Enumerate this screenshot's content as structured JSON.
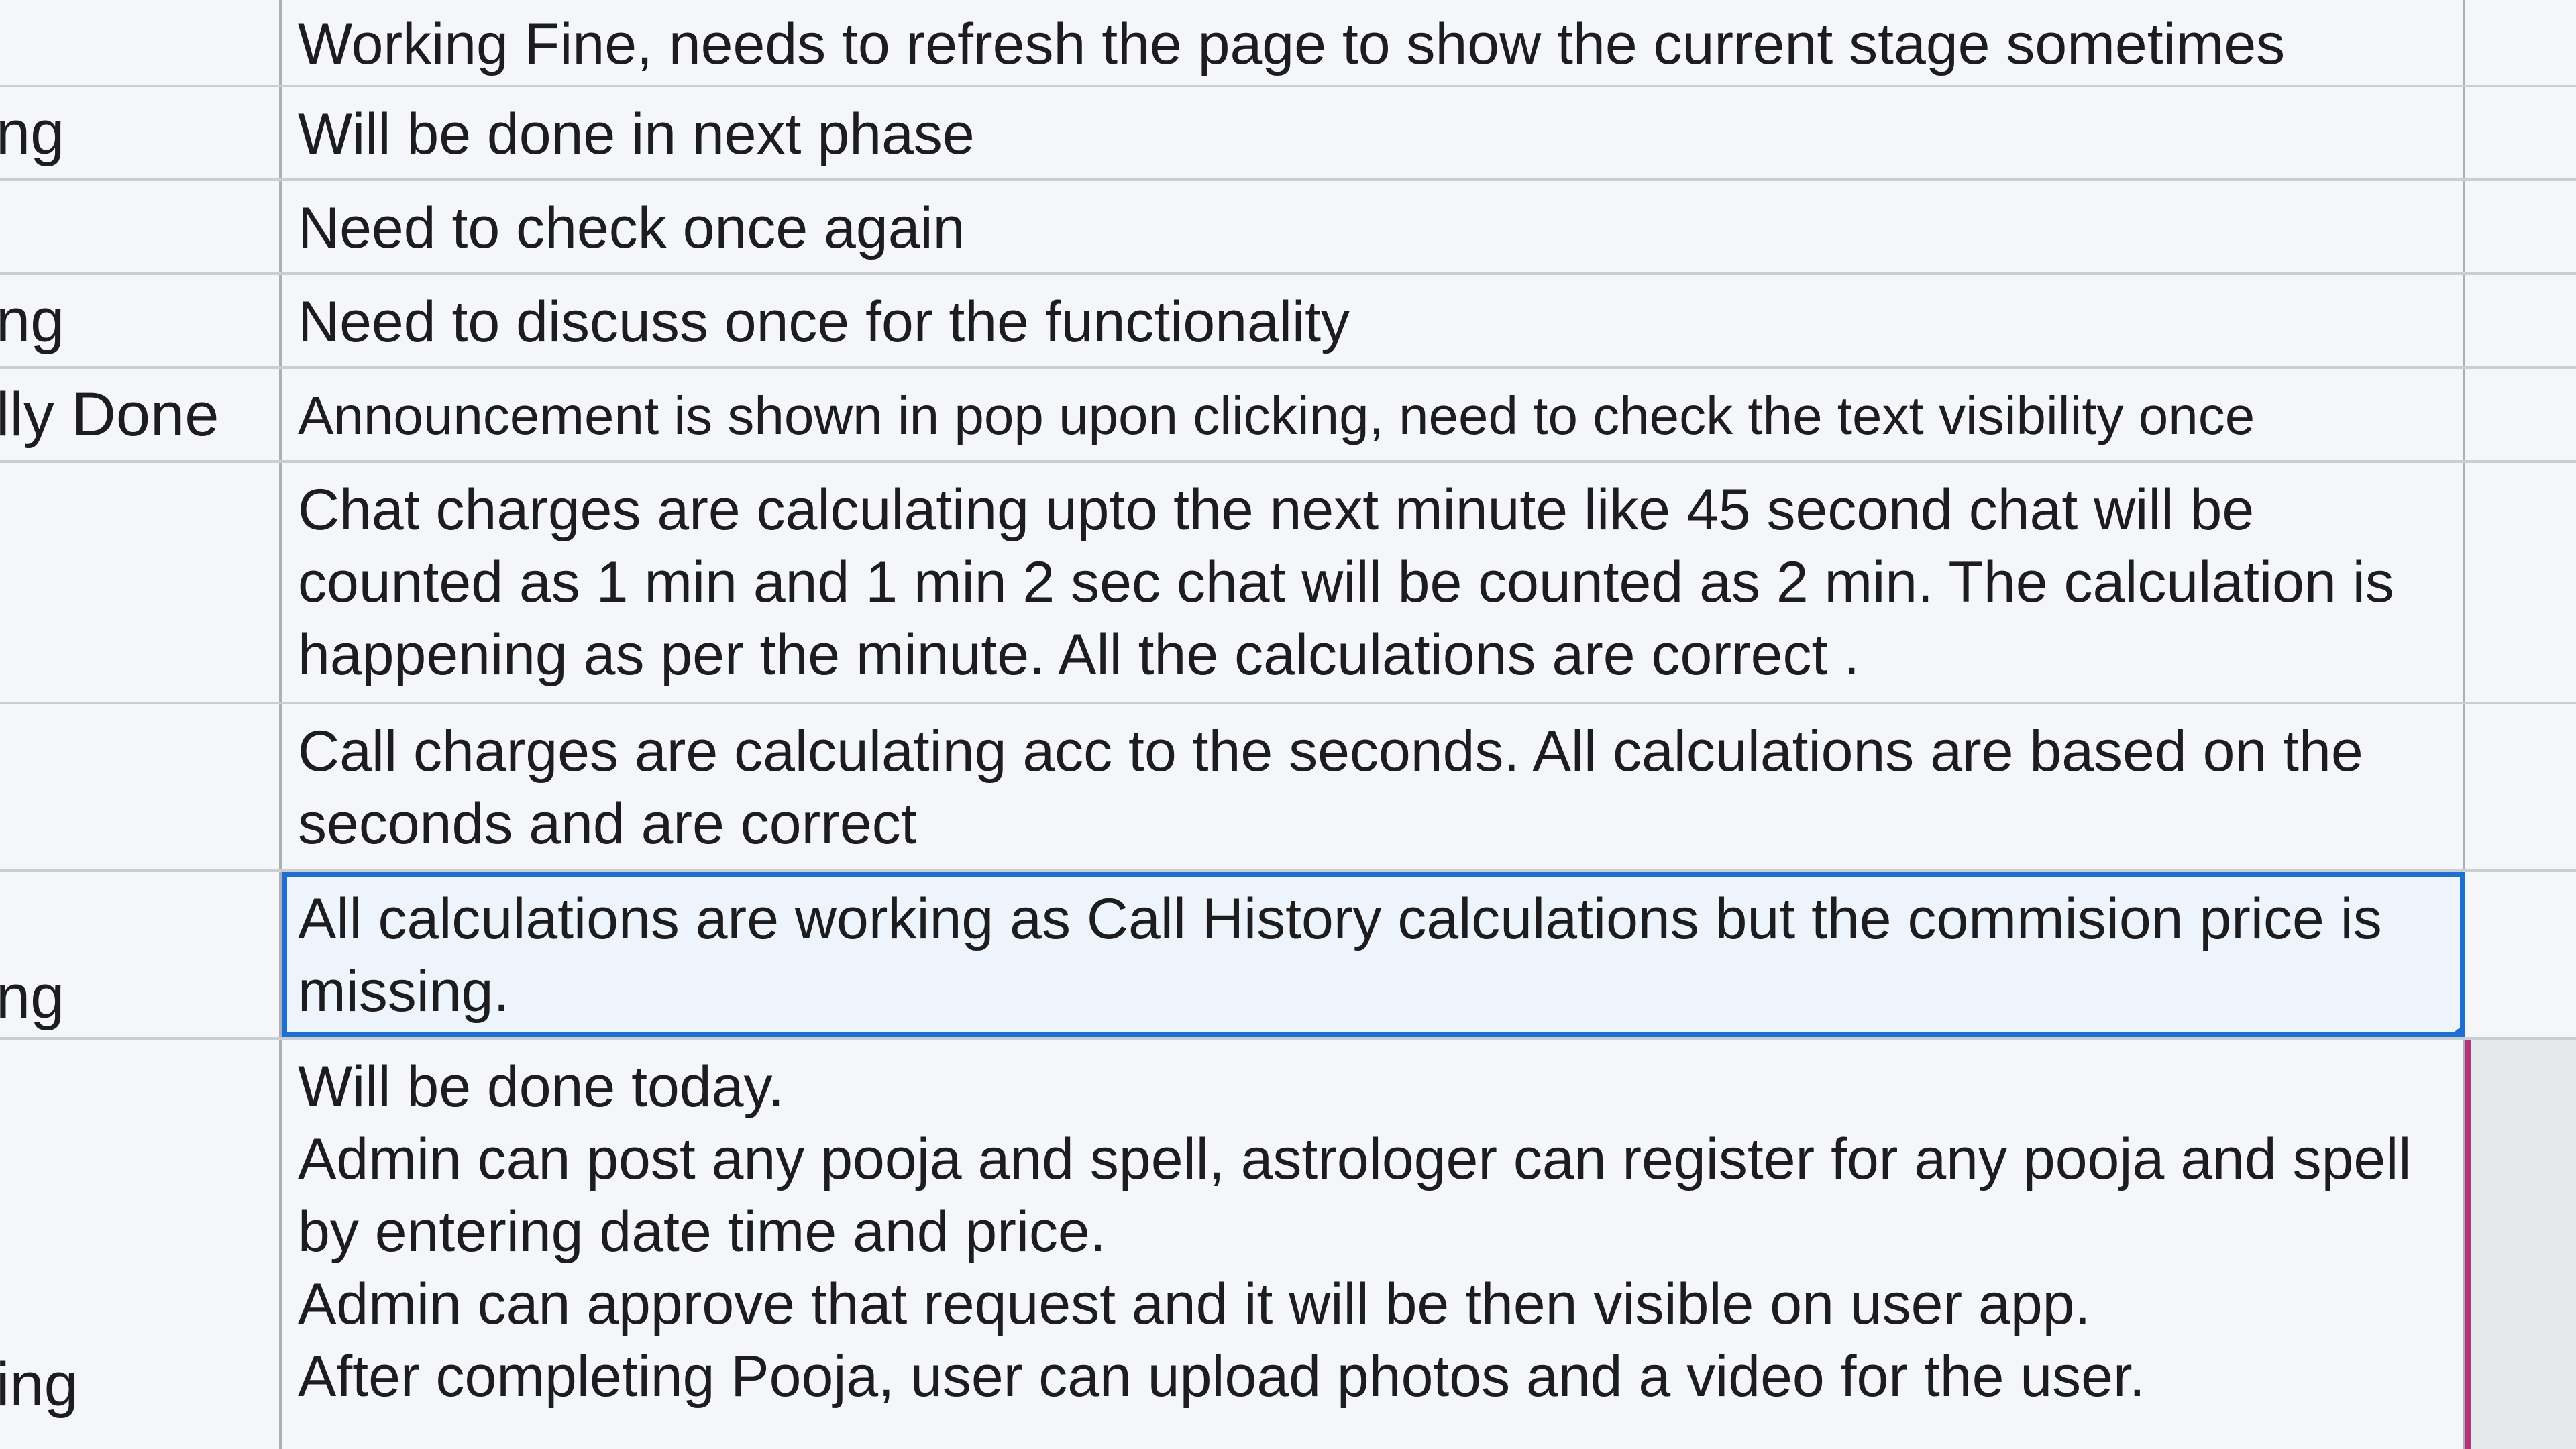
{
  "sheet": {
    "rows": [
      {
        "status": "",
        "remark": "Working Fine, needs to refresh the page to show the current stage sometimes"
      },
      {
        "status": "ng",
        "remark": "Will be done in next phase"
      },
      {
        "status": "",
        "remark": "Need to check once again"
      },
      {
        "status": "ng",
        "remark": "Need to discuss once for the functionality"
      },
      {
        "status": "lly Done",
        "remark": "Announcement is shown in pop upon clicking, need to check the text visibility once"
      },
      {
        "status": "",
        "remark": "Chat charges are calculating upto the next minute like 45 second chat will be counted as 1 min and 1 min 2 sec chat will be counted as 2 min. The calculation is happening as per the minute. All the calculations are correct ."
      },
      {
        "status": "",
        "remark": "Call charges are calculating acc to the seconds. All calculations are based on the seconds and are correct"
      },
      {
        "status": "ng",
        "remark": "All calculations are working as Call History calculations but the commision price is missing."
      },
      {
        "status": "ing",
        "remark": "Will be done today.\nAdmin can post any pooja and spell, astrologer can register for any pooja and spell by entering date time and price.\nAdmin can approve that request and it will be then visible on user app.\nAfter completing Pooja, user can upload photos and a video for the user."
      }
    ],
    "selected_row_index": 7,
    "colors": {
      "selection": "#1f6fd0",
      "accent_border": "#b0337a",
      "grid_line": "#c9ced3"
    }
  }
}
